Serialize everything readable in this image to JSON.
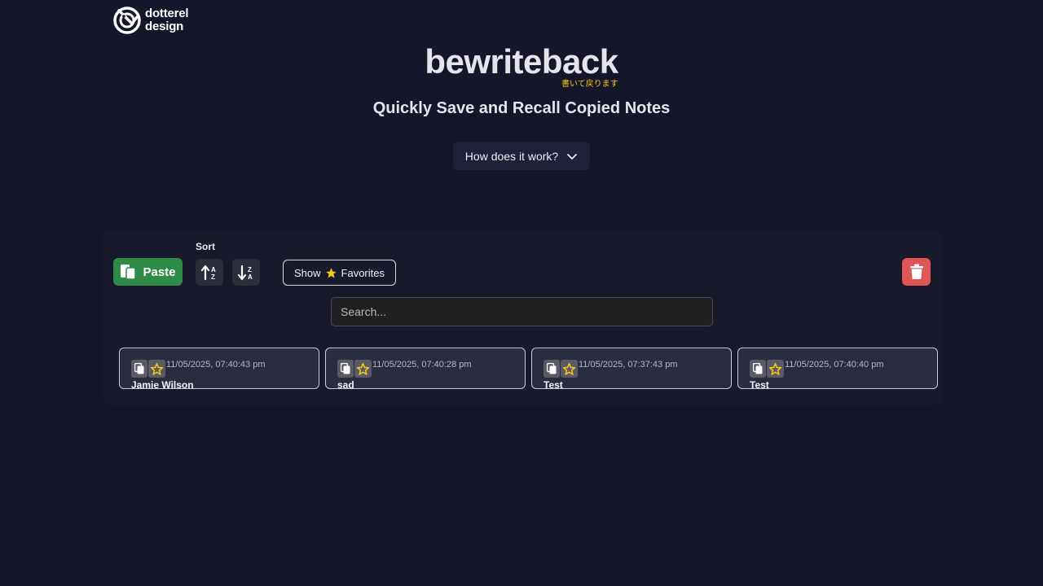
{
  "brand": {
    "line1": "dotterel",
    "line2": "design",
    "logo_icon": "dotterel-bird-logo-icon"
  },
  "hero": {
    "title": "bewriteback",
    "subtitle_jp": "書いて戻ります",
    "tagline": "Quickly Save and Recall Copied Notes",
    "how_label": "How does it work?"
  },
  "toolbar": {
    "paste_label": "Paste",
    "sort_label": "Sort",
    "show_label": "Show",
    "favorites_label": "Favorites"
  },
  "search": {
    "placeholder": "Search..."
  },
  "notes": [
    {
      "timestamp": "11/05/2025, 07:40:43 pm",
      "text": "Jamie Wilson"
    },
    {
      "timestamp": "11/05/2025, 07:40:28 pm",
      "text": "sad"
    },
    {
      "timestamp": "11/05/2025, 07:37:43 pm",
      "text": "Test"
    },
    {
      "timestamp": "11/05/2025, 07:40:40 pm",
      "text": "Test"
    }
  ],
  "colors": {
    "background": "#15162a",
    "paste": "#2e8b47",
    "delete": "#e05555",
    "star": "#f5c518",
    "jp_subtitle": "#f5c518"
  }
}
